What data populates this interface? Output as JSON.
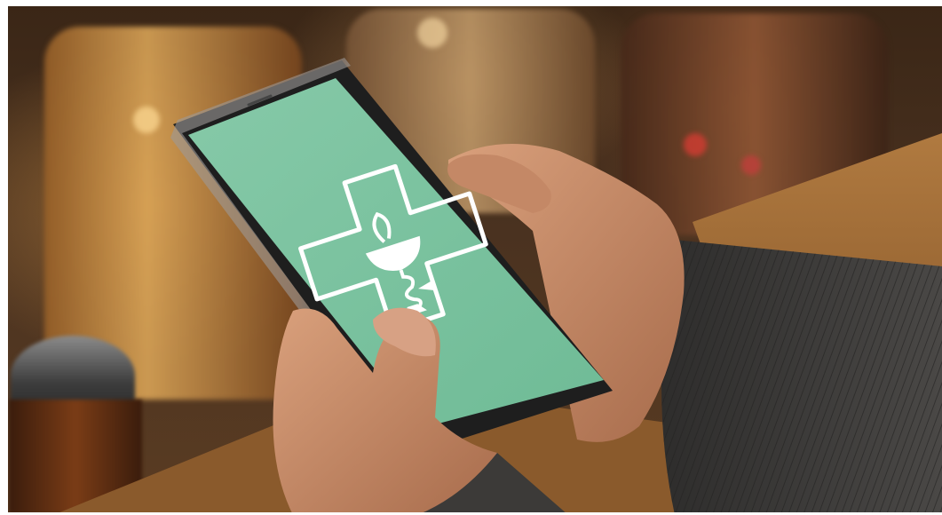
{
  "scene": {
    "colors": {
      "screen": "#7dc4a2",
      "sleeve": "#3c3a38",
      "skin": "#c88e6c",
      "counter": "#a8743c",
      "phone_frame": "#2a2a2a"
    }
  },
  "phone": {
    "screen_icon": "pharmacy-cross-icon"
  }
}
